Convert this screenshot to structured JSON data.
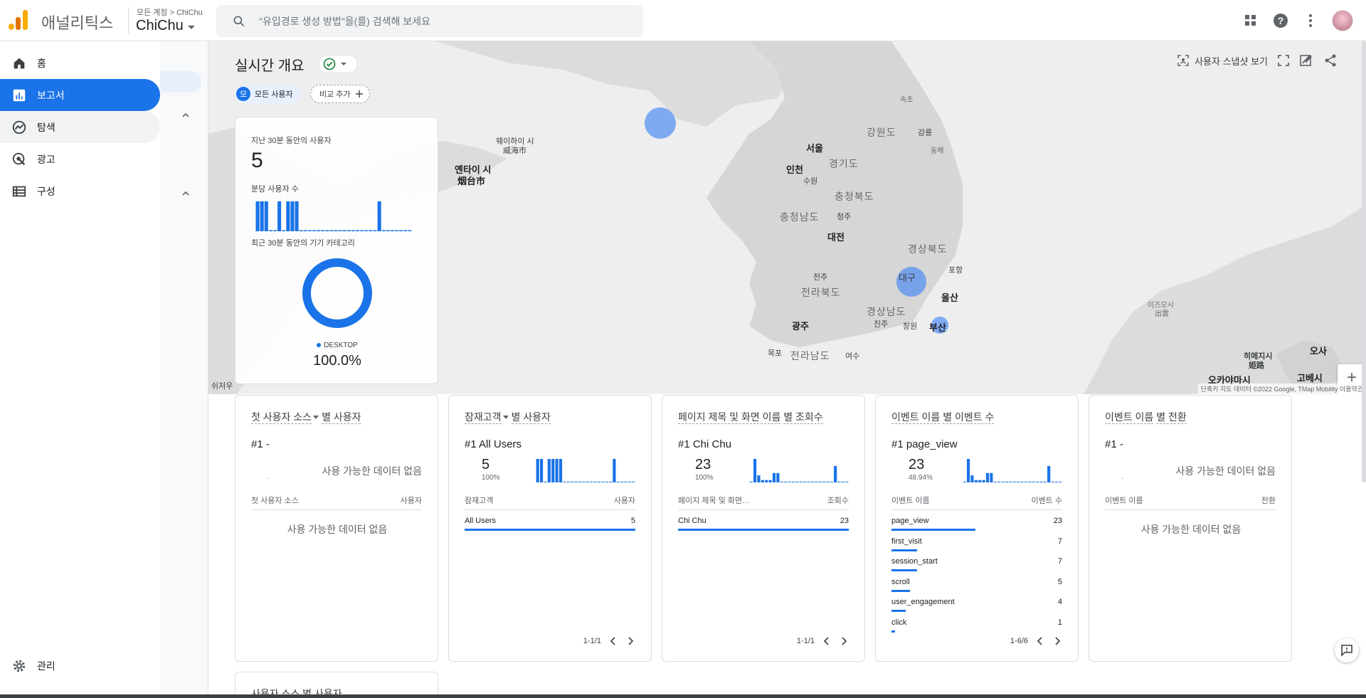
{
  "header": {
    "app_name": "애널리틱스",
    "breadcrumb": "모든 계정 > ChiChu",
    "property": "ChiChu",
    "search_placeholder": "\"유입경로 생성 방법\"을(를) 검색해 보세요"
  },
  "nav": {
    "items": [
      {
        "label": "홈",
        "icon": "home-icon"
      },
      {
        "label": "보고서",
        "icon": "bar-chart-icon"
      },
      {
        "label": "탐색",
        "icon": "explore-icon"
      },
      {
        "label": "광고",
        "icon": "ads-icon"
      },
      {
        "label": "구성",
        "icon": "table-icon"
      }
    ],
    "admin": "관리"
  },
  "realtime": {
    "title": "실시간 개요",
    "chip_user": "모든 사용자",
    "chip_user_initial": "모",
    "chip_add": "비교 추가",
    "snapshot": "사용자 스냅샷 보기",
    "users_30min_label": "지난 30분 동안의 사용자",
    "users_30min_value": "5",
    "per_min_label": "분당 사용자 수",
    "per_min_bars": [
      1,
      1,
      1,
      0,
      0,
      1,
      0,
      1,
      1,
      1,
      0,
      0,
      0,
      0,
      0,
      0,
      0,
      0,
      0,
      0,
      0,
      0,
      0,
      0,
      0,
      0,
      0,
      0,
      1,
      0,
      0,
      0,
      0,
      0,
      0,
      0
    ],
    "device_label": "최근 30분 동안의 기기 카테고리",
    "device_name": "DESKTOP",
    "device_pct": "100.0%"
  },
  "map": {
    "places": [
      "서울",
      "인천",
      "수원",
      "경기도",
      "강원도",
      "강릉",
      "동해",
      "속초",
      "충청북도",
      "충청남도",
      "청주",
      "대전",
      "경상북도",
      "포항",
      "대구",
      "울산",
      "전주",
      "전라북도",
      "광주",
      "진주",
      "창원",
      "부산",
      "경상남도",
      "목포",
      "전라남도",
      "여수",
      "웨이하이 시",
      "威海市",
      "옌타이 시",
      "烟台市",
      "이즈모시",
      "出雲",
      "오카야마시",
      "히메지시",
      "姫路",
      "고베시",
      "오사",
      "쉬저우"
    ],
    "footer": "단축키  지도 데이터 ©2022 Google, TMap Mobility  이용약관",
    "zoom_in": "+",
    "zoom_out": "−"
  },
  "cards": [
    {
      "title_a": "첫 사용자 소스",
      "title_b": "별 사용자",
      "rank": "#1  -",
      "nodata": "사용 가능한 데이터 없음",
      "dash": "-",
      "col_l": "첫 사용자 소스",
      "col_r": "사용자",
      "nodata2": "사용 가능한 데이터 없음"
    },
    {
      "title_a": "잠재고객",
      "title_b": "별 사용자",
      "rank": "#1  All Users",
      "value": "5",
      "pct": "100%",
      "col_l": "잠재고객",
      "col_r": "사용자",
      "rows": [
        {
          "name": "All Users",
          "value": "5",
          "fill": 1.0
        }
      ],
      "pager": "1-1/1"
    },
    {
      "title_a": "페이지 제목 및 화면 이름",
      "title_b": "별 조회수",
      "rank": "#1  Chi Chu",
      "value": "23",
      "pct": "100%",
      "col_l": "페이지 제목 및 화면…",
      "col_r": "조회수",
      "rows": [
        {
          "name": "Chi Chu",
          "value": "23",
          "fill": 1.0
        }
      ],
      "pager": "1-1/1"
    },
    {
      "title_a": "이벤트 이름",
      "title_b": "별 이벤트 수",
      "rank": "#1  page_view",
      "value": "23",
      "pct": "48.94%",
      "col_l": "이벤트 이름",
      "col_r": "이벤트 수",
      "rows": [
        {
          "name": "page_view",
          "value": "23",
          "fill": 0.49
        },
        {
          "name": "first_visit",
          "value": "7",
          "fill": 0.15
        },
        {
          "name": "session_start",
          "value": "7",
          "fill": 0.15
        },
        {
          "name": "scroll",
          "value": "5",
          "fill": 0.11
        },
        {
          "name": "user_engagement",
          "value": "4",
          "fill": 0.085
        },
        {
          "name": "click",
          "value": "1",
          "fill": 0.02
        }
      ],
      "pager": "1-6/6"
    },
    {
      "title_a": "이벤트 이름",
      "title_b": "별 전환",
      "rank": "#1  -",
      "nodata": "사용 가능한 데이터 없음",
      "dash": "-",
      "col_l": "이벤트 이름",
      "col_r": "전환",
      "nodata2": "사용 가능한 데이터 없음"
    }
  ],
  "bottom_card_title": "사용자 소스 별 사용자",
  "colors": {
    "accent": "#1a73e8",
    "bubble": "#4285f4"
  }
}
